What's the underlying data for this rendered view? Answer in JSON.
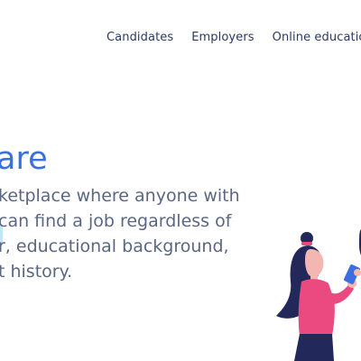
{
  "nav": {
    "items": [
      {
        "label": "Candidates"
      },
      {
        "label": "Employers"
      },
      {
        "label": "Online education"
      }
    ]
  },
  "hero": {
    "title": "are",
    "lines": [
      "ketplace where anyone with",
      "can find a job regardless of",
      "r, educational background,",
      "t history."
    ]
  },
  "colors": {
    "accent": "#3b6fe0",
    "nav_text": "#2a3a63",
    "body_text": "#5b6782",
    "figure_hair": "#23285a",
    "figure_top": "#ea4a7f",
    "figure_skin": "#f4b6b0"
  },
  "icons": {
    "illustration": "woman-with-phone-illustration"
  }
}
